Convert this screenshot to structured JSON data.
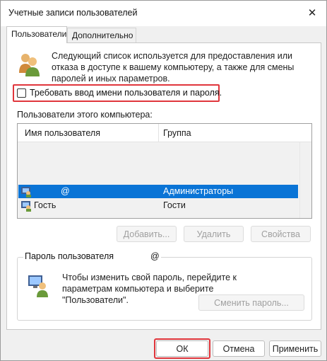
{
  "window": {
    "title": "Учетные записи пользователей"
  },
  "tabs": [
    {
      "label": "Пользователи",
      "active": true
    },
    {
      "label": "Дополнительно",
      "active": false
    }
  ],
  "intro": {
    "text": "Следующий список используется для предоставления или отказа в доступе к вашему компьютеру, а также для смены паролей и иных параметров."
  },
  "require_login": {
    "label": "Требовать ввод имени пользователя и пароля.",
    "checked": false
  },
  "users_caption": "Пользователи этого компьютера:",
  "users_table": {
    "columns": [
      "Имя пользователя",
      "Группа"
    ],
    "rows": [
      {
        "name": "@",
        "group": "Администраторы",
        "selected": true
      },
      {
        "name": "Гость",
        "group": "Гости",
        "selected": false
      }
    ]
  },
  "user_buttons": {
    "add": "Добавить...",
    "remove": "Удалить",
    "properties": "Свойства"
  },
  "password_group": {
    "label": "Пароль пользователя",
    "label_suffix": "@",
    "text": "Чтобы изменить свой пароль, перейдите к параметрам компьютера и выберите \"Пользователи\".",
    "change_button": "Сменить пароль..."
  },
  "footer": {
    "ok": "ОК",
    "cancel": "Отмена",
    "apply": "Применить"
  },
  "colors": {
    "selection": "#0a74d6",
    "highlight": "#e0363c"
  }
}
